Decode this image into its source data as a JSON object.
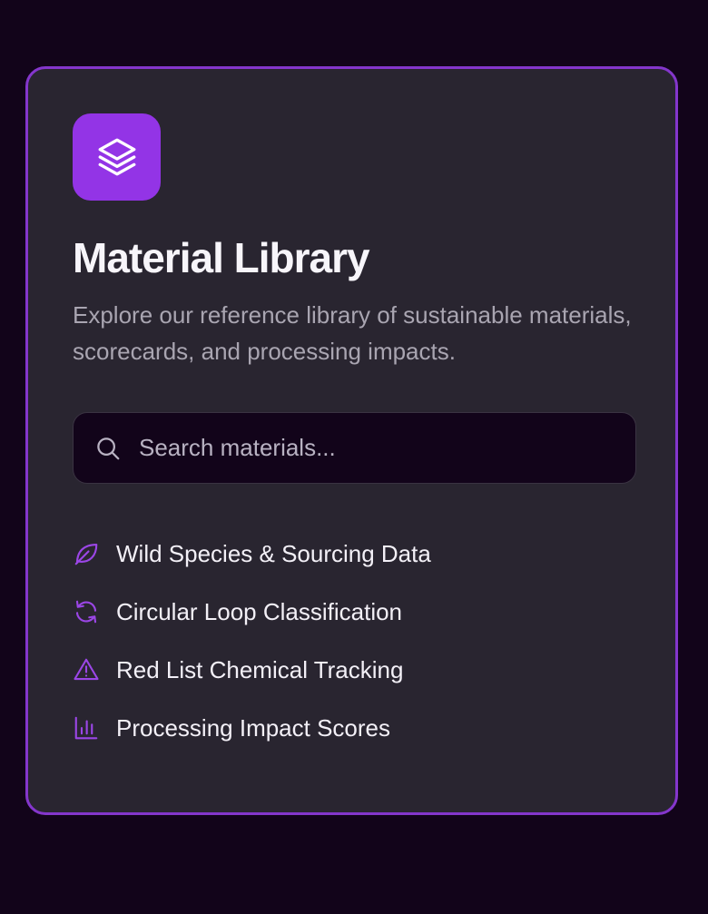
{
  "colors": {
    "page_background": "#12041a",
    "card_background": "#292530",
    "accent": "#9334e6",
    "card_border": "#8436cc",
    "title_text": "#f7f5fa",
    "muted_text": "#a9a5b1"
  },
  "card": {
    "logo_icon": "layers-icon",
    "title": "Material Library",
    "description": "Explore our reference library of sustainable materials, scorecards, and processing impacts."
  },
  "search": {
    "icon": "search-icon",
    "placeholder": "Search materials...",
    "value": ""
  },
  "features": [
    {
      "icon": "leaf-icon",
      "label": "Wild Species & Sourcing Data"
    },
    {
      "icon": "refresh-cycle-icon",
      "label": "Circular Loop Classification"
    },
    {
      "icon": "warning-triangle-icon",
      "label": "Red List Chemical Tracking"
    },
    {
      "icon": "bar-chart-icon",
      "label": "Processing Impact Scores"
    }
  ]
}
